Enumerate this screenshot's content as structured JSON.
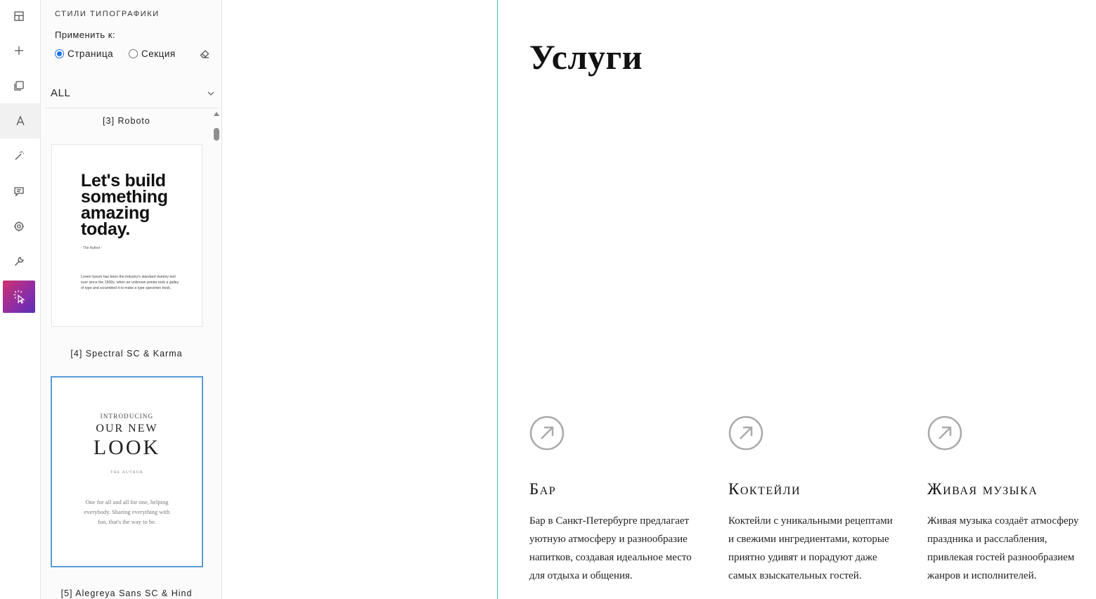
{
  "panel": {
    "title": "СТИЛИ ТИПОГРАФИКИ",
    "apply_label": "Применить к:",
    "radio_page": "Страница",
    "radio_section": "Секция",
    "filter_value": "ALL"
  },
  "fonts": [
    {
      "label": "[3] Roboto",
      "preview": {
        "headline_lines": [
          "Let's build",
          "something",
          "amazing",
          "today."
        ],
        "author": "- The Author -",
        "body": "Lorem Ipsum has been the industry's standard dummy text ever since the 1500s, when an unknown printer took a galley of type and scrambled it to make a type specimen book."
      }
    },
    {
      "label": "[4] Spectral SC & Karma",
      "preview": {
        "intro": "INTRODUCING",
        "line1": "OUR NEW",
        "line2": "LOOK",
        "author": "THE AUTHOR",
        "body": "One for all and all for one, helping everybody. Sharing everything with fun, that's the way to be."
      }
    },
    {
      "label": "[5] Alegreya Sans SC & Hind"
    }
  ],
  "content": {
    "heading": "Услуги",
    "services": [
      {
        "title": "Бар",
        "text": "Бар в Санкт-Петербурге предлагает уютную атмосферу и разнообразие напитков, создавая идеальное место для отдыха и общения."
      },
      {
        "title": "Коктейли",
        "text": "Коктейли с уникальными рецептами и свежими ингредиентами, которые приятно удивят и порадуют даже самых взыскательных гостей."
      },
      {
        "title": "Живая музыка",
        "text": "Живая музыка создаёт атмосферу праздника и расслабления, привлекая гостей разнообразием жанров и исполнителей."
      }
    ]
  },
  "colors": {
    "divider": "#3fbfae",
    "selected_border": "#5b9bd5",
    "radio_accent": "#1a73e8",
    "brand_gradient_start": "#d0306f",
    "brand_gradient_end": "#5b2fb4"
  },
  "icons": {
    "rail": [
      "layout-grid-icon",
      "plus-icon",
      "pages-icon",
      "typography-icon",
      "magic-wand-icon",
      "comment-icon",
      "gear-icon",
      "wrench-icon",
      "cursor-click-icon"
    ],
    "panel": [
      "eraser-icon",
      "chevron-down-icon"
    ],
    "service": "arrow-up-right-circle-icon"
  }
}
